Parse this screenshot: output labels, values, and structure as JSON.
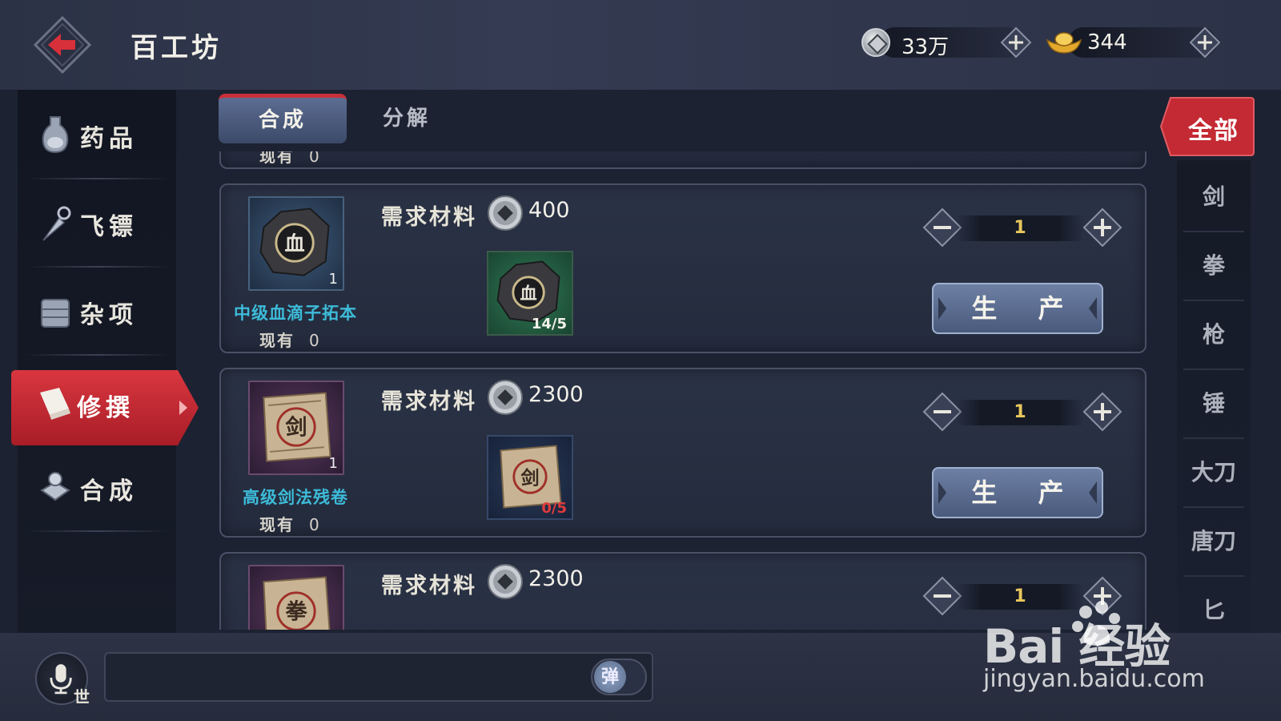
{
  "header": {
    "title": "百工坊",
    "silver": "33万",
    "gold": "344"
  },
  "left_menu": {
    "items": [
      {
        "label": "药品",
        "icon": "potion-icon"
      },
      {
        "label": "飞镖",
        "icon": "dart-icon"
      },
      {
        "label": "杂项",
        "icon": "chest-icon"
      },
      {
        "label": "修撰",
        "icon": "book-icon",
        "active": true
      },
      {
        "label": "合成",
        "icon": "anvil-icon"
      }
    ]
  },
  "tabs": [
    {
      "label": "合成",
      "active": true
    },
    {
      "label": "分解",
      "active": false
    }
  ],
  "partial_top": {
    "owned_label": "现有",
    "owned": "0"
  },
  "recipes": [
    {
      "item_name": "中级血滴子拓本",
      "item_count": "1",
      "owned_label": "现有",
      "owned": "0",
      "req_label": "需求材料",
      "cost": "400",
      "material_count": "14/5",
      "material_ok": true,
      "quantity": "1",
      "produce_label": "生 产"
    },
    {
      "item_name": "高级剑法残卷",
      "item_count": "1",
      "owned_label": "现有",
      "owned": "0",
      "req_label": "需求材料",
      "cost": "2300",
      "material_count": "0/5",
      "material_ok": false,
      "quantity": "1",
      "produce_label": "生 产"
    },
    {
      "item_name": "",
      "req_label": "需求材料",
      "cost": "2300",
      "quantity": "1"
    }
  ],
  "filters": [
    "全部",
    "剑",
    "拳",
    "枪",
    "锤",
    "大刀",
    "唐刀",
    "匕"
  ],
  "chat": {
    "world_label": "世",
    "danmaku_label": "弹"
  },
  "watermark": {
    "brand": "Bai  经验",
    "url": "jingyan.baidu.com"
  },
  "colors": {
    "accent_red": "#c9303a",
    "item_name_cyan": "#3dbbd8",
    "quantity_gold": "#e8c75c",
    "lack_red": "#e03b3b"
  }
}
